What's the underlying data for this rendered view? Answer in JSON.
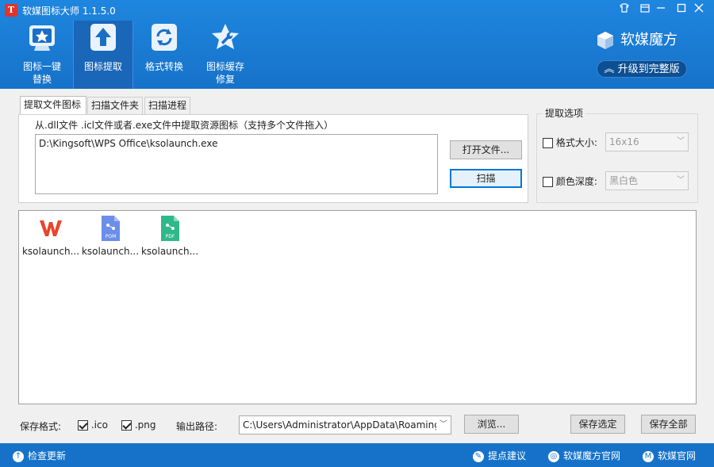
{
  "window": {
    "title": "软媒图标大师 1.1.5.0",
    "app_icon_glyph": "T"
  },
  "toolbar": [
    {
      "label": "图标一键\n替换",
      "icon": "monitor-star-icon"
    },
    {
      "label": "图标提取",
      "icon": "upload-arrow-icon",
      "active": true
    },
    {
      "label": "格式转换",
      "icon": "refresh-icon"
    },
    {
      "label": "图标缓存\n修复",
      "icon": "star-wrench-icon"
    }
  ],
  "brand": {
    "name": "软媒魔方",
    "upgrade": "升级到完整版"
  },
  "tabs": [
    "提取文件图标",
    "扫描文件夹",
    "扫描进程"
  ],
  "extract": {
    "hint": "从.dll文件 .icl文件或者.exe文件中提取资源图标（支持多个文件拖入）",
    "path": "D:\\Kingsoft\\WPS Office\\ksolaunch.exe",
    "open_button": "打开文件...",
    "scan_button": "扫描"
  },
  "options": {
    "title": "提取选项",
    "size_label": "格式大小:",
    "size_value": "16x16",
    "depth_label": "颜色深度:",
    "depth_value": "黑白色"
  },
  "icons": [
    {
      "name": "ksolaunch...",
      "kind": "wps-logo-icon"
    },
    {
      "name": "ksolaunch...",
      "kind": "pom-file-icon",
      "badge": "POM"
    },
    {
      "name": "ksolaunch...",
      "kind": "pdf-file-icon",
      "badge": "PDF"
    }
  ],
  "bottom": {
    "format_label": "保存格式:",
    "ico_label": ".ico",
    "png_label": ".png",
    "output_label": "输出路径:",
    "output_path": "C:\\Users\\Administrator\\AppData\\Roaming",
    "browse": "浏览...",
    "save_selected": "保存选定",
    "save_all": "保存全部"
  },
  "status": {
    "check_update": "检查更新",
    "suggest": "提点建议",
    "mofang_site": "软媒魔方官网",
    "ruanmei_site": "软媒官网"
  },
  "colors": {
    "accent": "#1672c9",
    "wps_red": "#e8452c",
    "pom_blue": "#6b8ee8",
    "pdf_green": "#2fb88a"
  }
}
